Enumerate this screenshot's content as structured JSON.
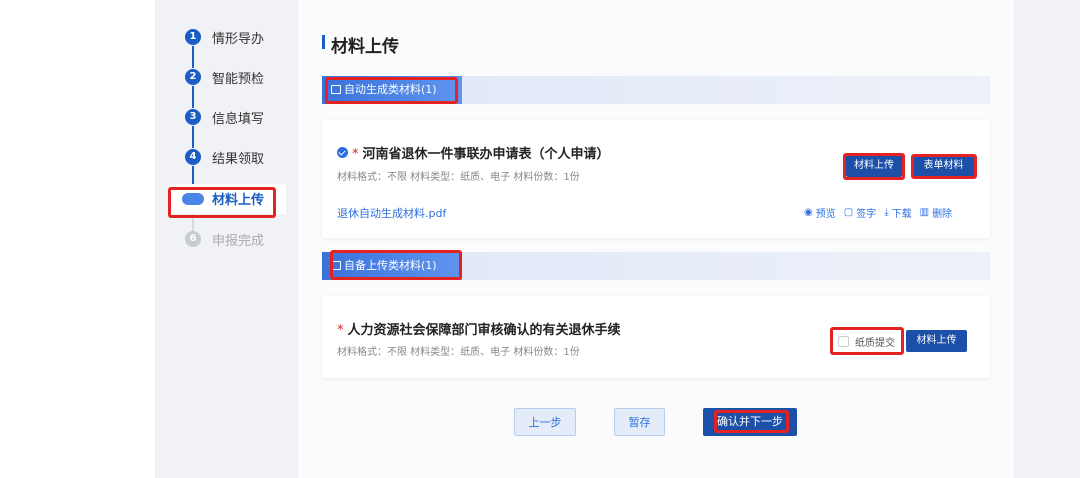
{
  "steps": [
    {
      "num": "1",
      "label": "情形导办",
      "state": "done"
    },
    {
      "num": "2",
      "label": "智能预检",
      "state": "done"
    },
    {
      "num": "3",
      "label": "信息填写",
      "state": "done"
    },
    {
      "num": "4",
      "label": "结果领取",
      "state": "done"
    },
    {
      "num": "",
      "label": "材料上传",
      "state": "active"
    },
    {
      "num": "6",
      "label": "申报完成",
      "state": "pending"
    }
  ],
  "page": {
    "title": "材料上传"
  },
  "section_auto": {
    "label": "自动生成类材料(1)"
  },
  "section_self": {
    "label": "自备上传类材料(1)"
  },
  "doc1": {
    "title": "河南省退休一件事联办申请表（个人申请）",
    "meta": "材料格式：不限  材料类型：纸质、电子  材料份数：1份",
    "file": "退休自动生成材料.pdf",
    "upload_label": "材料上传",
    "form_label": "表单材料",
    "actions": {
      "preview": "预览",
      "sign": "签字",
      "download": "下载",
      "delete": "删除"
    }
  },
  "doc2": {
    "title": "人力资源社会保障部门审核确认的有关退休手续",
    "meta": "材料格式：不限  材料类型：纸质、电子  材料份数：1份",
    "paper_label": "纸质提交",
    "upload_label": "材料上传"
  },
  "footer": {
    "prev": "上一步",
    "save": "暂存",
    "next": "确认并下一步"
  },
  "colors": {
    "primary": "#1b4fa8",
    "accent": "#2d6fe0",
    "highlight": "#e52222"
  }
}
